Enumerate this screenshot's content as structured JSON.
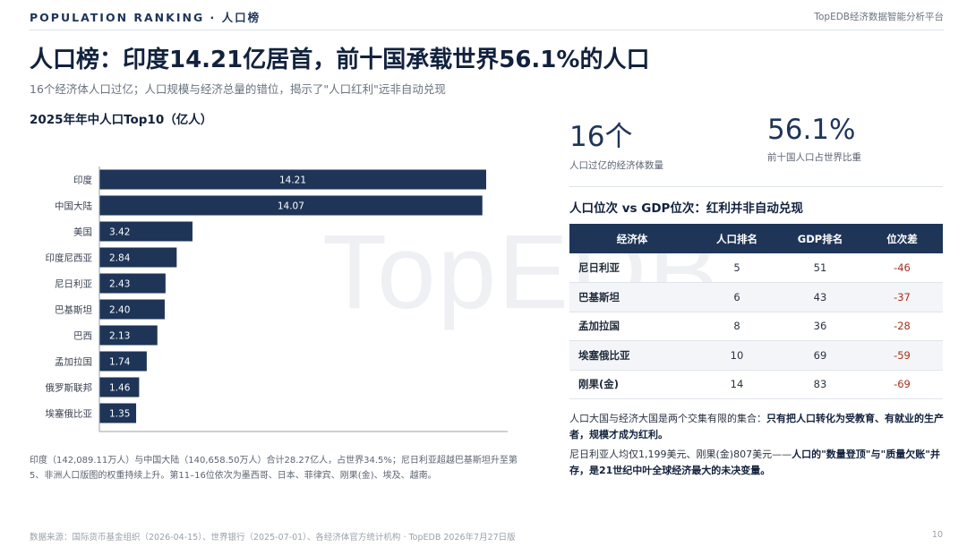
{
  "header": {
    "section_label": "POPULATION RANKING · 人口榜",
    "platform": "TopEDB经济数据智能分析平台"
  },
  "title": "人口榜：印度14.21亿居首，前十国承载世界56.1%的人口",
  "subtitle": "16个经济体人口过亿；人口规模与经济总量的错位，揭示了\"人口红利\"远非自动兑现",
  "watermark": "TopEDB",
  "chart_data": {
    "type": "bar",
    "orientation": "horizontal",
    "title": "2025年年中人口Top10（亿人）",
    "categories": [
      "印度",
      "中国大陆",
      "美国",
      "印度尼西亚",
      "尼日利亚",
      "巴基斯坦",
      "巴西",
      "孟加拉国",
      "俄罗斯联邦",
      "埃塞俄比亚"
    ],
    "values": [
      14.21,
      14.07,
      3.42,
      2.84,
      2.43,
      2.4,
      2.13,
      1.74,
      1.46,
      1.35
    ],
    "value_labels": [
      "14.21",
      "14.07",
      "3.42",
      "2.84",
      "2.43",
      "2.40",
      "2.13",
      "1.74",
      "1.46",
      "1.35"
    ],
    "xlim": [
      0,
      15
    ],
    "xticks": [
      0,
      3,
      6,
      9,
      12,
      15
    ],
    "grid": false,
    "bar_color": "#1e3558"
  },
  "chart_note": "印度（142,089.11万人）与中国大陆（140,658.50万人）合计28.27亿人，占世界34.5%；尼日利亚超越巴基斯坦升至第5、非洲人口版图的权重持续上升。第11–16位依次为墨西哥、日本、菲律宾、刚果(金)、埃及、越南。",
  "stats": [
    {
      "value": "16个",
      "label": "人口过亿的经济体数量"
    },
    {
      "value": "56.1%",
      "label": "前十国人口占世界比重"
    }
  ],
  "table": {
    "title": "人口位次 vs GDP位次：红利并非自动兑现",
    "headers": [
      "经济体",
      "人口排名",
      "GDP排名",
      "位次差"
    ],
    "rows": [
      {
        "name": "尼日利亚",
        "pop_rank": "5",
        "gdp_rank": "51",
        "diff": "-46"
      },
      {
        "name": "巴基斯坦",
        "pop_rank": "6",
        "gdp_rank": "43",
        "diff": "-37"
      },
      {
        "name": "孟加拉国",
        "pop_rank": "8",
        "gdp_rank": "36",
        "diff": "-28"
      },
      {
        "name": "埃塞俄比亚",
        "pop_rank": "10",
        "gdp_rank": "69",
        "diff": "-59"
      },
      {
        "name": "刚果(金)",
        "pop_rank": "14",
        "gdp_rank": "83",
        "diff": "-69"
      }
    ],
    "diff_color": "#a3331f"
  },
  "insight": {
    "p1_plain": "人口大国与经济大国是两个交集有限的集合：",
    "p1_bold": "只有把人口转化为受教育、有就业的生产者，规模才成为红利。",
    "p2_plain": "尼日利亚人均仅1,199美元、刚果(金)807美元——",
    "p2_bold": "人口的\"数量登顶\"与\"质量欠账\"并存，是21世纪中叶全球经济最大的未决变量。"
  },
  "footer": {
    "source": "数据来源：国际货币基金组织（2026-04-15）、世界银行（2025-07-01）、各经济体官方统计机构 · TopEDB 2026年7月27日版",
    "page": "10"
  }
}
